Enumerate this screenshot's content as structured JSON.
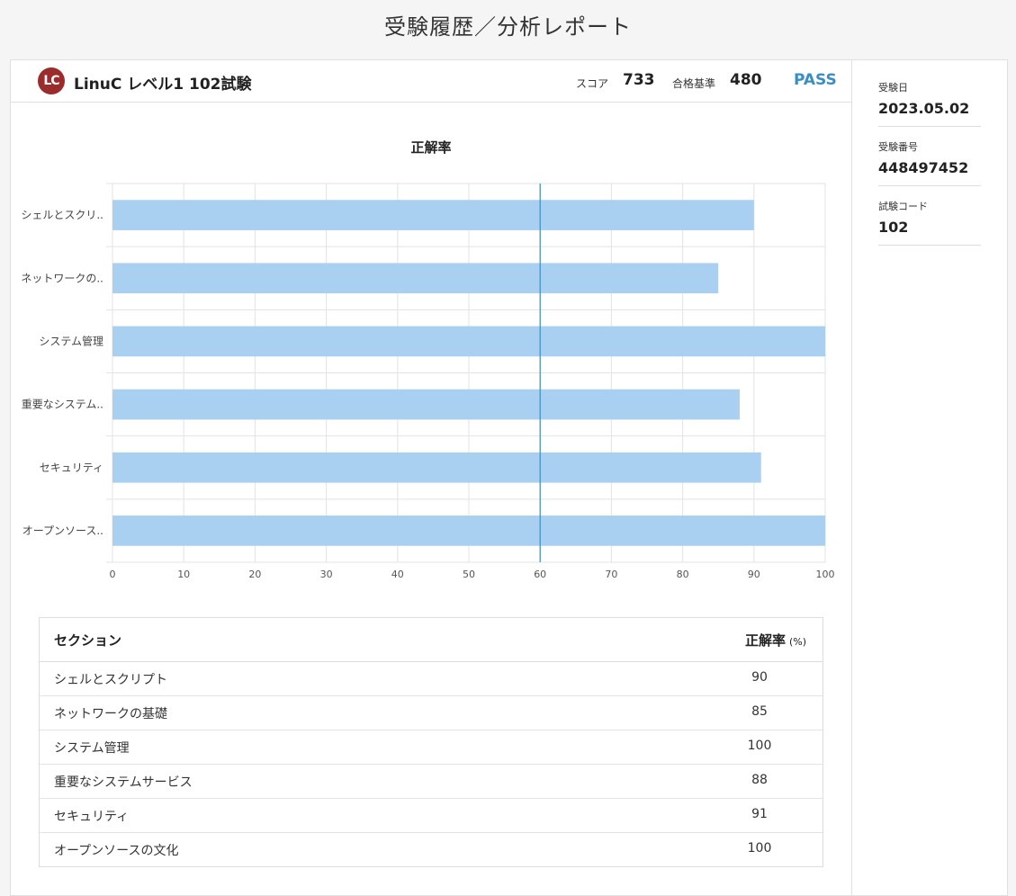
{
  "page_title": "受験履歴／分析レポート",
  "header": {
    "logo_text": "LC",
    "exam_name": "LinuC レベル1 102試験",
    "score_label": "スコア",
    "score_value": "733",
    "pass_line_label": "合格基準",
    "pass_line_value": "480",
    "result": "PASS"
  },
  "chart_data": {
    "type": "bar",
    "orientation": "horizontal",
    "title": "正解率",
    "categories": [
      "シェルとスクリ..",
      "ネットワークの..",
      "システム管理",
      "重要なシステム..",
      "セキュリティ",
      "オープンソース.."
    ],
    "values": [
      90,
      85,
      100,
      88,
      91,
      100
    ],
    "xlim": [
      0,
      100
    ],
    "x_ticks": [
      0,
      10,
      20,
      30,
      40,
      50,
      60,
      70,
      80,
      90,
      100
    ],
    "reference_line": 60,
    "bar_color": "#a9d0f0",
    "reference_color": "#3a8ec2",
    "grid": true
  },
  "table": {
    "header_section": "セクション",
    "header_rate": "正解率",
    "header_unit": "(%)",
    "rows": [
      {
        "section": "シェルとスクリプト",
        "rate": "90"
      },
      {
        "section": "ネットワークの基礎",
        "rate": "85"
      },
      {
        "section": "システム管理",
        "rate": "100"
      },
      {
        "section": "重要なシステムサービス",
        "rate": "88"
      },
      {
        "section": "セキュリティ",
        "rate": "91"
      },
      {
        "section": "オープンソースの文化",
        "rate": "100"
      }
    ]
  },
  "sidebar": {
    "items": [
      {
        "label": "受験日",
        "value": "2023.05.02"
      },
      {
        "label": "受験番号",
        "value": "448497452"
      },
      {
        "label": "試験コード",
        "value": "102"
      }
    ]
  }
}
